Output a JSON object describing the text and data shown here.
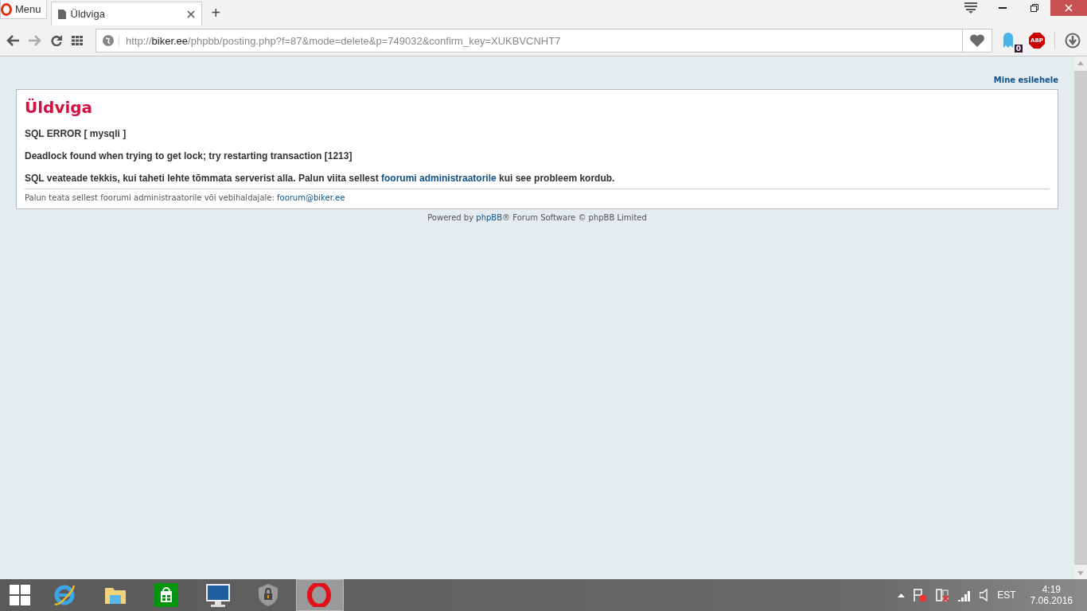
{
  "browser": {
    "menu_label": "Menu",
    "tabs": [
      {
        "title": "Üldviga",
        "selected": true
      }
    ],
    "new_tab": "+",
    "url": {
      "scheme": "http://",
      "host": "biker.ee",
      "path": "/phpbb/posting.php?f=87&mode=delete&p=749032&confirm_key=XUKBVCNHT7"
    },
    "ghostery_count": "0",
    "adblock_label": "ABP"
  },
  "page": {
    "home_link": "Mine esilehele",
    "title": "Üldviga",
    "messages": [
      {
        "text": "SQL ERROR [ mysqli ]"
      },
      {
        "text": "Deadlock found when trying to get lock; try restarting transaction [1213]"
      },
      {
        "text": "SQL veateade tekkis, kui taheti lehte tõmmata serverist alla. Palun viita sellest ",
        "link": "foorumi administraatorile",
        "after": " kui see probleem kordub."
      }
    ],
    "footer_text": "Palun teata sellest foorumi administraatorile või vebihaldajale: ",
    "footer_link": "foorum@biker.ee",
    "powered_before": "Powered by ",
    "powered_link": "phpBB",
    "powered_after": "® Forum Software © phpBB Limited"
  },
  "taskbar": {
    "apps": [
      {
        "kind": "ie",
        "active": false
      },
      {
        "kind": "explorer",
        "active": false
      },
      {
        "kind": "store",
        "active": false
      },
      {
        "kind": "monitor",
        "active": false
      },
      {
        "kind": "shield",
        "active": false
      },
      {
        "kind": "opera",
        "active": true
      }
    ],
    "language": "EST",
    "time": "4:19",
    "date": "7.06.2016"
  }
}
